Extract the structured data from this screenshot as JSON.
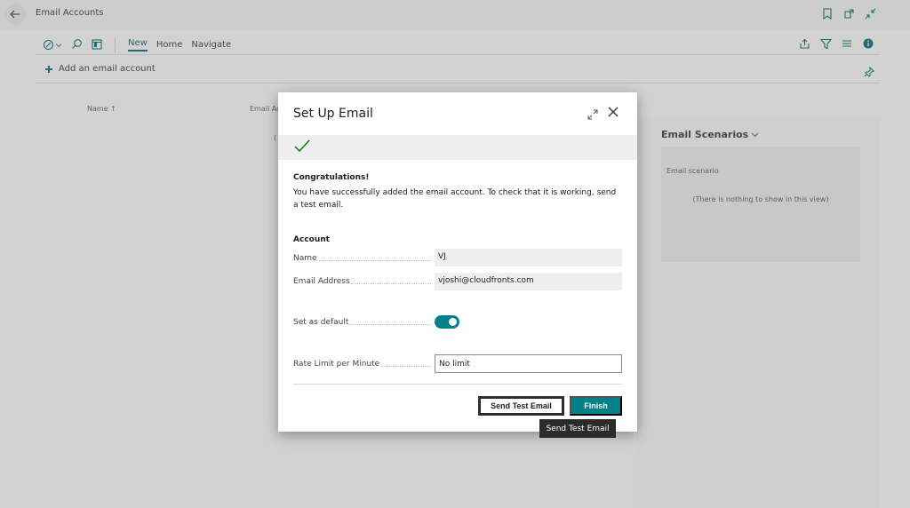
{
  "page": {
    "title": "Email Accounts",
    "tabs": [
      "New",
      "Home",
      "Navigate"
    ],
    "add_account_label": "Add an email account",
    "columns": {
      "name": "Name ↑",
      "email": "Email Ad",
      "partial": "("
    }
  },
  "factbox": {
    "title": "Email Scenarios",
    "column": "Email scenario",
    "empty_text": "(There is nothing to show in this view)"
  },
  "dialog": {
    "title": "Set Up Email",
    "congrats": "Congratulations!",
    "message": "You have successfully added the email account. To check that it is working, send a test email.",
    "account_header": "Account",
    "fields": {
      "name_label": "Name",
      "name_value": "VJ",
      "email_label": "Email Address",
      "email_value": "vjoshi@cloudfronts.com",
      "default_label": "Set as default",
      "default_value": "on",
      "rate_label": "Rate Limit per Minute",
      "rate_value": "No limit"
    },
    "buttons": {
      "send_test": "Send Test Email",
      "finish": "Finish"
    },
    "tooltip": "Send Test Email"
  },
  "colors": {
    "accent": "#00808a",
    "tab_active": "#00656b"
  },
  "icons": [
    "back-arrow-icon",
    "bookmark-icon",
    "open-new-window-icon",
    "collapse-icon",
    "analysis-icon",
    "search-icon",
    "layout-icon",
    "share-icon",
    "filter-icon",
    "list-icon",
    "info-icon",
    "plus-icon",
    "pin-icon",
    "expand-icon",
    "close-icon",
    "check-icon",
    "chevron-down-icon"
  ]
}
